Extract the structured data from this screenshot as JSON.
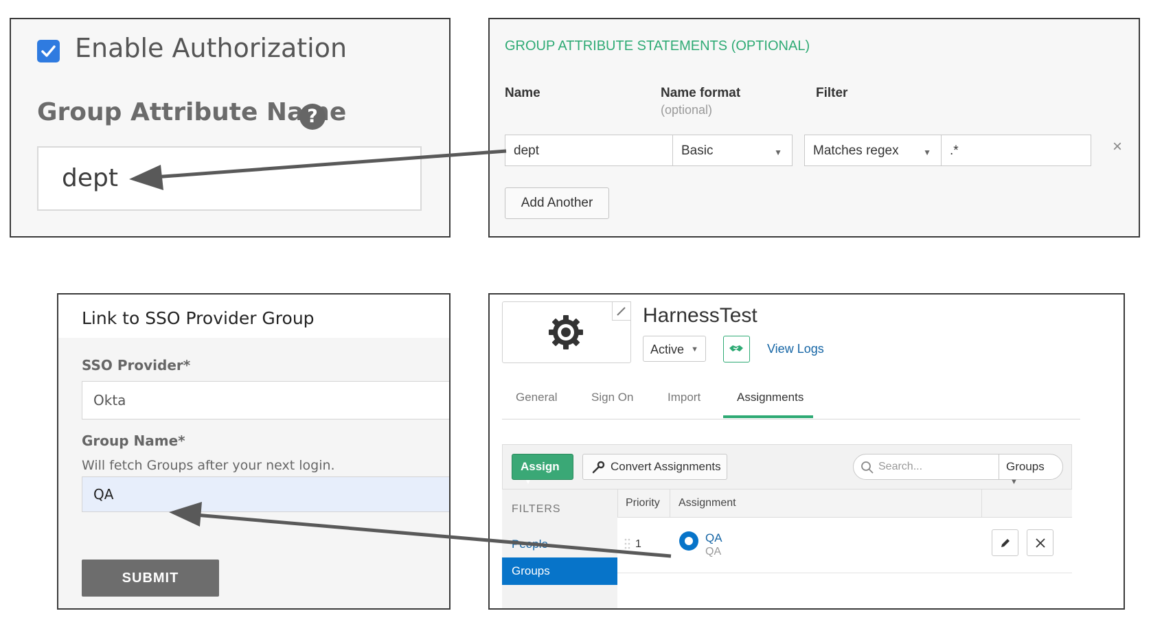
{
  "auth_panel": {
    "checkbox_label": "Enable Authorization",
    "checked": true,
    "attribute_label": "Group Attribute Name",
    "help_symbol": "?",
    "attribute_value": "dept"
  },
  "okta_attr_panel": {
    "title": "GROUP ATTRIBUTE STATEMENTS (OPTIONAL)",
    "col_name": "Name",
    "col_name_format": "Name format",
    "col_name_format_hint": "(optional)",
    "col_filter": "Filter",
    "name_value": "dept",
    "format_value": "Basic",
    "filter_type": "Matches regex",
    "filter_value": ".*",
    "remove_symbol": "×",
    "add_button": "Add Another"
  },
  "sso_link_panel": {
    "title": "Link to SSO Provider Group",
    "provider_label": "SSO Provider*",
    "provider_value": "Okta",
    "group_label": "Group Name*",
    "group_hint": "Will fetch Groups after your next login.",
    "group_value": "QA",
    "submit_label": "SUBMIT"
  },
  "okta_app_panel": {
    "app_name": "HarnessTest",
    "status": "Active",
    "view_logs": "View Logs",
    "tabs": [
      {
        "label": "General",
        "active": false
      },
      {
        "label": "Sign On",
        "active": false
      },
      {
        "label": "Import",
        "active": false
      },
      {
        "label": "Assignments",
        "active": true
      }
    ],
    "assign_button": "Assign",
    "convert_button": "Convert Assignments",
    "search_placeholder": "Search...",
    "search_scope": "Groups",
    "filters_header": "FILTERS",
    "filter_people": "People",
    "filter_groups": "Groups",
    "col_priority": "Priority",
    "col_assignment": "Assignment",
    "rows": [
      {
        "priority": "1",
        "name": "QA",
        "sub": "QA"
      }
    ]
  },
  "colors": {
    "accent_green": "#2eaa74",
    "link_blue": "#1565a5",
    "selected_blue": "#0774c9",
    "checkbox_blue": "#2f7be0"
  }
}
